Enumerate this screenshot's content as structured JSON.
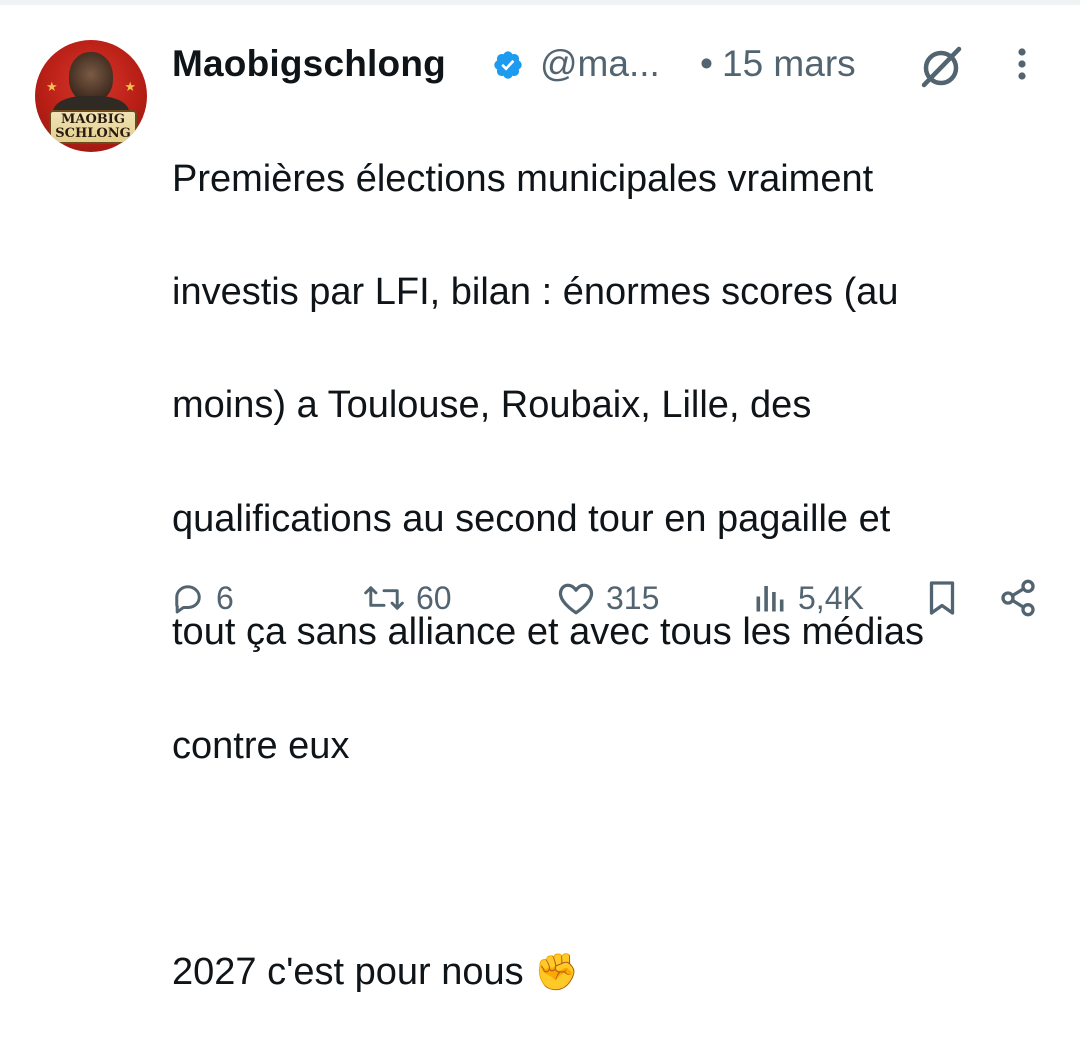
{
  "tweet": {
    "author_name": "Maobigschlong",
    "handle": "@ma...",
    "dot": "•",
    "date": "15 mars",
    "avatar_text_line1": "MAOBIG",
    "avatar_text_line2": "SCHLONG",
    "body_lines": [
      "Premières élections municipales vraiment",
      "investis par LFI, bilan : énormes scores (au",
      "moins) a Toulouse, Roubaix, Lille, des",
      "qualifications au second tour en pagaille et",
      "tout ça sans alliance et avec tous les médias",
      "contre eux",
      "",
      "2027 c'est pour nous "
    ],
    "body_emoji": "✊"
  },
  "actions": {
    "replies": "6",
    "retweets": "60",
    "likes": "315",
    "views": "5,4K"
  },
  "icons": {
    "verified": "verified-badge-icon",
    "grok": "grok-icon",
    "more": "more-vertical-icon",
    "reply": "reply-icon",
    "retweet": "retweet-icon",
    "like": "heart-icon",
    "views": "views-chart-icon",
    "bookmark": "bookmark-icon",
    "share": "share-icon"
  },
  "colors": {
    "text": "#0f1419",
    "secondary": "#536471",
    "verified_blue": "#1d9bf0",
    "avatar_red": "#b81f16",
    "emoji_yellow": "#f6c026"
  }
}
